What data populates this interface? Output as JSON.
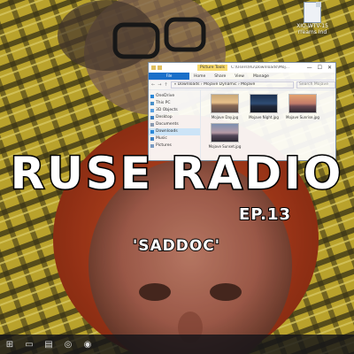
{
  "desktop_icon": {
    "label_line1": "XIO-WTV-15",
    "label_line2": "rreams Ind"
  },
  "window": {
    "context_tab": "Picture Tools",
    "path_title": "C:\\Users\\Ru\\Downloads\\Moj...",
    "controls": [
      "—",
      "☐",
      "✕"
    ],
    "ribbon": {
      "file": "File",
      "tabs": [
        "Home",
        "Share",
        "View",
        "Manage"
      ]
    },
    "address": {
      "path": "« Downloads › Mojave Dynamic › Mojave",
      "search_placeholder": "Search Mojave"
    },
    "nav_items": [
      {
        "label": "OneDrive",
        "color": "#2b88d8"
      },
      {
        "label": "This PC",
        "color": "#4a90c8"
      },
      {
        "label": "3D Objects",
        "color": "#5aa0e0"
      },
      {
        "label": "Desktop",
        "color": "#3c7fc0"
      },
      {
        "label": "Documents",
        "color": "#8a9ab0"
      },
      {
        "label": "Downloads",
        "color": "#2b88d8"
      },
      {
        "label": "Music",
        "color": "#3c7fc0"
      },
      {
        "label": "Pictures",
        "color": "#7a9ac0"
      }
    ],
    "selected_nav": "Downloads",
    "files": [
      {
        "name": "Mojave Day.jpg",
        "thumb": "t-day"
      },
      {
        "name": "Mojave Night.jpg",
        "thumb": "t-night"
      },
      {
        "name": "Mojave Sunrise.jpg",
        "thumb": "t-sunrise"
      },
      {
        "name": "Mojave Sunset.jpg",
        "thumb": "t-sunset"
      }
    ]
  },
  "title": "RUSE RADIO",
  "episode": "EP.13",
  "subtitle": "'SADDOC'",
  "taskbar": {
    "icons": [
      "start-icon",
      "task-view-icon",
      "file-explorer-icon",
      "settings-icon",
      "chrome-icon"
    ]
  }
}
